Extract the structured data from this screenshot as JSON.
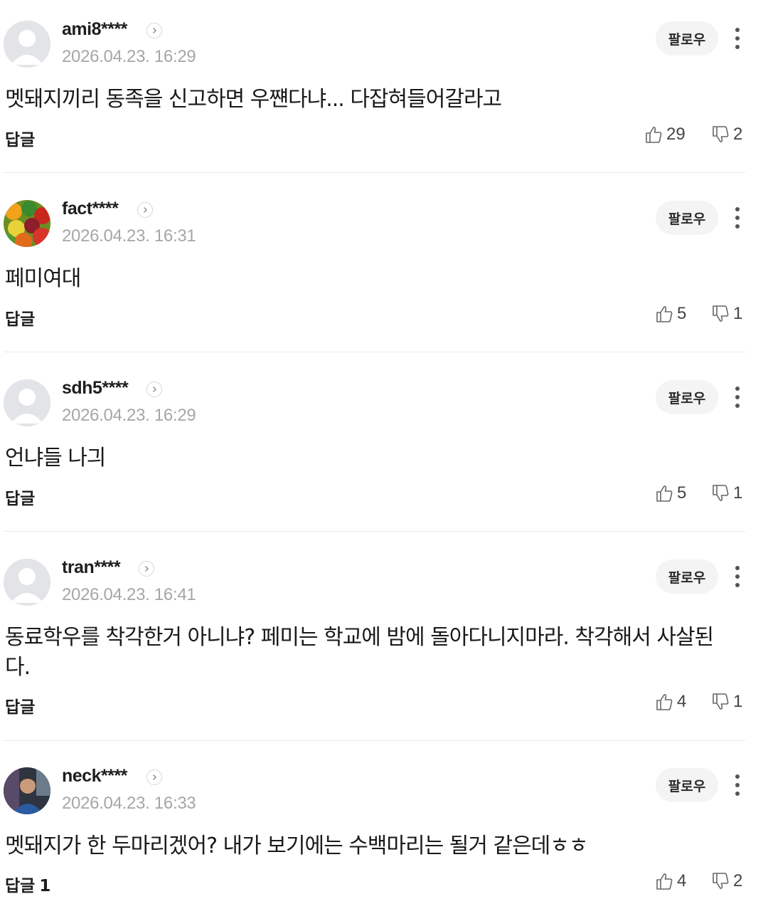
{
  "follow_label": "팔로우",
  "reply_label": "답글",
  "comments": [
    {
      "username": "ami8****",
      "timestamp": "2026.04.23. 16:29",
      "text": "멧돼지끼리 동족을 신고하면 우쨴다냐... 다잡혀들어갈라고",
      "likes": "29",
      "dislikes": "2",
      "reply_count": "",
      "avatar": "default-avatar"
    },
    {
      "username": "fact****",
      "timestamp": "2026.04.23. 16:31",
      "text": "페미여대",
      "likes": "5",
      "dislikes": "1",
      "reply_count": "",
      "avatar": "fruit-photo-avatar"
    },
    {
      "username": "sdh5****",
      "timestamp": "2026.04.23. 16:29",
      "text": "언냐들 나긔",
      "likes": "5",
      "dislikes": "1",
      "reply_count": "",
      "avatar": "default-avatar"
    },
    {
      "username": "tran****",
      "timestamp": "2026.04.23. 16:41",
      "text": "동료학우를 착각한거 아니냐? 페미는 학교에 밤에 돌아다니지마라. 착각해서 사살된다.",
      "likes": "4",
      "dislikes": "1",
      "reply_count": "",
      "avatar": "default-avatar"
    },
    {
      "username": "neck****",
      "timestamp": "2026.04.23. 16:33",
      "text": "멧돼지가 한 두마리겠어? 내가 보기에는 수백마리는 될거 같은데ㅎㅎ",
      "likes": "4",
      "dislikes": "2",
      "reply_count": "1",
      "avatar": "person-photo-avatar"
    }
  ]
}
